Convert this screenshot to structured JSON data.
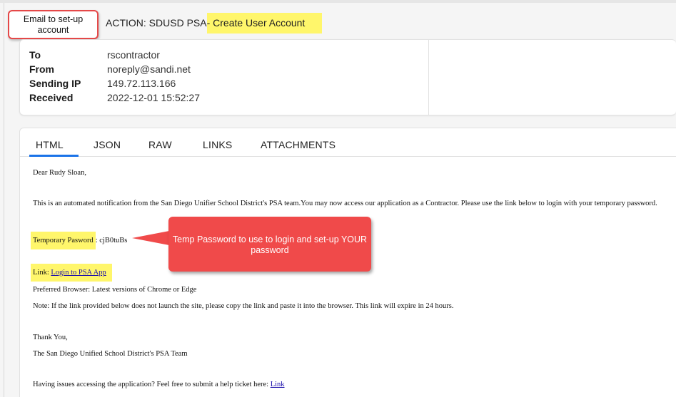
{
  "email": {
    "subject_prefix": "ACTION: SDUSD PSA",
    "subject_highlight": "- Create User Account",
    "meta": {
      "to_label": "To",
      "to_value": "rscontractor",
      "from_label": "From",
      "from_value": "noreply@sandi.net",
      "ip_label": "Sending IP",
      "ip_value": "149.72.113.166",
      "received_label": "Received",
      "received_value": "2022-12-01 15:52:27"
    },
    "tabs": [
      {
        "label": "HTML",
        "active": true
      },
      {
        "label": "JSON",
        "active": false
      },
      {
        "label": "RAW",
        "active": false
      },
      {
        "label": "LINKS",
        "active": false
      },
      {
        "label": "ATTACHMENTS",
        "active": false
      }
    ],
    "body": {
      "greeting": "Dear Rudy Sloan,",
      "intro": "This is an automated notification from the San Diego Unifier School District's PSA team.You may now access our application as a Contractor. Please use the link below to login with your temporary password.",
      "temp_label": "Temporary Pasword",
      "temp_value": ": cjB0tuBs",
      "link_label": "Link:",
      "link_text": "Login to PSA App",
      "browser": "Preferred Browser: Latest versions of Chrome or Edge",
      "note": "Note: If the link provided below does not launch the site, please copy the link and paste it into the browser. This link will expire in 24 hours.",
      "thanks": "Thank You,",
      "signature": "The San Diego Unified School District's PSA Team",
      "help_text": "Having issues accessing the application? Feel free to submit a help ticket here:",
      "help_link": "Link"
    }
  },
  "annotations": {
    "email_callout": "Email to set-up account",
    "temp_callout": "Temp Password to use to login and set-up YOUR password"
  },
  "colors": {
    "highlight": "#fff66b",
    "callout_red": "#f04a4a",
    "tab_accent": "#1a73e8",
    "link": "#1a0dab"
  }
}
